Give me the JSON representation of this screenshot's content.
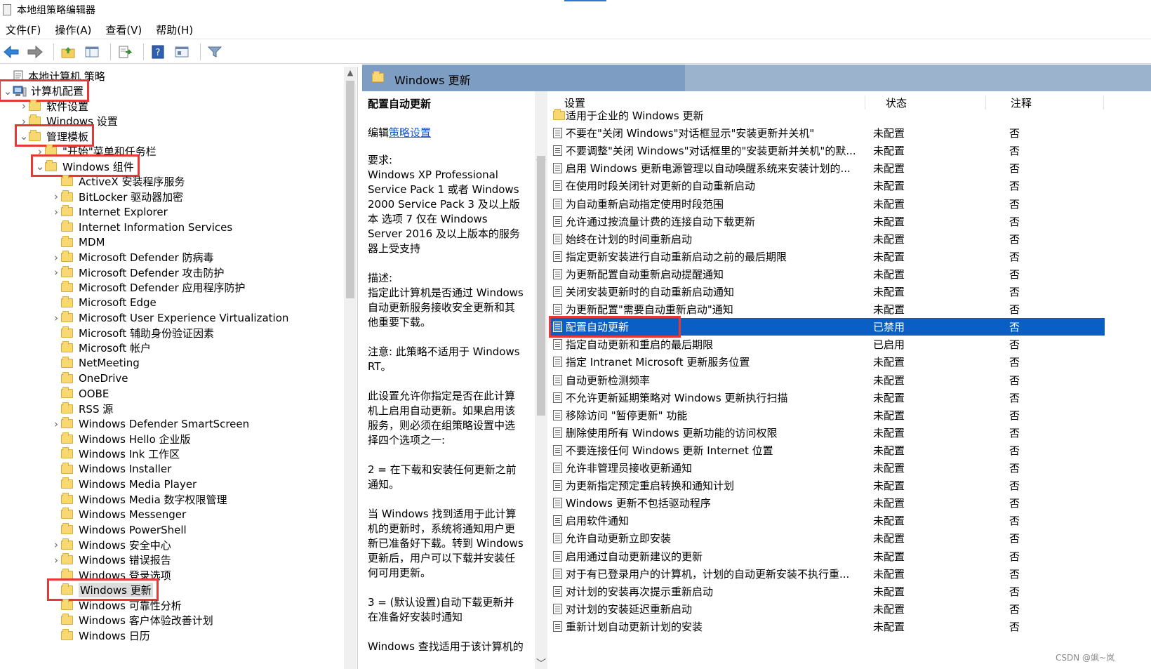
{
  "window": {
    "title": "本地组策略编辑器"
  },
  "menu": [
    "文件(F)",
    "操作(A)",
    "查看(V)",
    "帮助(H)"
  ],
  "toolbar": [
    "back-icon",
    "forward-icon",
    "up-folder-icon",
    "show-tree-icon",
    "export-icon",
    "help-icon",
    "properties-icon",
    "filter-icon"
  ],
  "tree": {
    "items": [
      {
        "label": "本地计算机 策略",
        "level": 0,
        "expander": "none",
        "icon": "policy-icon"
      },
      {
        "label": "计算机配置",
        "level": 0,
        "expander": "expanded",
        "icon": "computer-icon",
        "highlight": true
      },
      {
        "label": "软件设置",
        "level": 1,
        "expander": "collapsed"
      },
      {
        "label": "Windows 设置",
        "level": 1,
        "expander": "collapsed"
      },
      {
        "label": "管理模板",
        "level": 1,
        "expander": "expanded",
        "highlight": true
      },
      {
        "label": "\"开始\"菜单和任务栏",
        "level": 2,
        "expander": "collapsed"
      },
      {
        "label": "Windows 组件",
        "level": 2,
        "expander": "expanded",
        "highlight": true
      },
      {
        "label": "ActiveX 安装程序服务",
        "level": 3,
        "expander": "none"
      },
      {
        "label": "BitLocker 驱动器加密",
        "level": 3,
        "expander": "collapsed"
      },
      {
        "label": "Internet Explorer",
        "level": 3,
        "expander": "collapsed"
      },
      {
        "label": "Internet Information Services",
        "level": 3,
        "expander": "none"
      },
      {
        "label": "MDM",
        "level": 3,
        "expander": "none"
      },
      {
        "label": "Microsoft Defender 防病毒",
        "level": 3,
        "expander": "collapsed"
      },
      {
        "label": "Microsoft Defender 攻击防护",
        "level": 3,
        "expander": "collapsed"
      },
      {
        "label": "Microsoft Defender 应用程序防护",
        "level": 3,
        "expander": "none"
      },
      {
        "label": "Microsoft Edge",
        "level": 3,
        "expander": "none"
      },
      {
        "label": "Microsoft User Experience Virtualization",
        "level": 3,
        "expander": "collapsed"
      },
      {
        "label": "Microsoft 辅助身份验证因素",
        "level": 3,
        "expander": "none"
      },
      {
        "label": "Microsoft 帐户",
        "level": 3,
        "expander": "none"
      },
      {
        "label": "NetMeeting",
        "level": 3,
        "expander": "none"
      },
      {
        "label": "OneDrive",
        "level": 3,
        "expander": "none"
      },
      {
        "label": "OOBE",
        "level": 3,
        "expander": "none"
      },
      {
        "label": "RSS 源",
        "level": 3,
        "expander": "none"
      },
      {
        "label": "Windows Defender SmartScreen",
        "level": 3,
        "expander": "collapsed"
      },
      {
        "label": "Windows Hello 企业版",
        "level": 3,
        "expander": "none"
      },
      {
        "label": "Windows Ink 工作区",
        "level": 3,
        "expander": "none"
      },
      {
        "label": "Windows Installer",
        "level": 3,
        "expander": "none"
      },
      {
        "label": "Windows Media Player",
        "level": 3,
        "expander": "none"
      },
      {
        "label": "Windows Media 数字权限管理",
        "level": 3,
        "expander": "none"
      },
      {
        "label": "Windows Messenger",
        "level": 3,
        "expander": "none"
      },
      {
        "label": "Windows PowerShell",
        "level": 3,
        "expander": "none"
      },
      {
        "label": "Windows 安全中心",
        "level": 3,
        "expander": "collapsed"
      },
      {
        "label": "Windows 错误报告",
        "level": 3,
        "expander": "collapsed"
      },
      {
        "label": "Windows 登录选项",
        "level": 3,
        "expander": "none"
      },
      {
        "label": "Windows 更新",
        "level": 3,
        "expander": "none",
        "highlight": true,
        "selected": true
      },
      {
        "label": "Windows 可靠性分析",
        "level": 3,
        "expander": "none"
      },
      {
        "label": "Windows 客户体验改善计划",
        "level": 3,
        "expander": "none"
      },
      {
        "label": "Windows 日历",
        "level": 3,
        "expander": "none"
      }
    ]
  },
  "details": {
    "header_title": "Windows 更新",
    "extended": {
      "title": "配置自动更新",
      "edit_prefix": "编辑",
      "edit_link": "策略设置",
      "req_label": "要求:",
      "req_text": "Windows XP Professional Service Pack 1 或者 Windows 2000 Service Pack 3 及以上版本 选项 7 仅在 Windows Server 2016 及以上版本的服务器上受支持",
      "desc_label": "描述:",
      "desc_text": "指定此计算机是否通过 Windows 自动更新服务接收安全更新和其他重要下载。",
      "note_text": "注意: 此策略不适用于 Windows RT。",
      "para1": "此设置允许你指定是否在此计算机上启用自动更新。如果启用该服务，则必须在组策略设置中选择四个选项之一:",
      "para2": "2 = 在下载和安装任何更新之前通知。",
      "para3": "当 Windows 找到适用于此计算机的更新时，系统将通知用户更新已准备好下载。转到 Windows 更新后，用户可以下载并安装任何可用更新。",
      "para4": "3 = (默认设置)自动下载更新并在准备好安装时通知",
      "para5": "Windows 查找适用于该计算机的"
    },
    "columns": {
      "setting": "设置",
      "state": "状态",
      "note": "注释"
    },
    "rows": [
      {
        "name": "适用于企业的 Windows 更新",
        "state": "",
        "note": "",
        "type": "folder"
      },
      {
        "name": "不要在\"关闭 Windows\"对话框显示\"安装更新并关机\"",
        "state": "未配置",
        "note": "否"
      },
      {
        "name": "不要调整\"关闭 Windows\"对话框里的\"安装更新并关机\"的默...",
        "state": "未配置",
        "note": "否"
      },
      {
        "name": "启用 Windows 更新电源管理以自动唤醒系统来安装计划的...",
        "state": "未配置",
        "note": "否"
      },
      {
        "name": "在使用时段关闭针对更新的自动重新启动",
        "state": "未配置",
        "note": "否"
      },
      {
        "name": "为自动重新启动指定使用时段范围",
        "state": "未配置",
        "note": "否"
      },
      {
        "name": "允许通过按流量计费的连接自动下载更新",
        "state": "未配置",
        "note": "否"
      },
      {
        "name": "始终在计划的时间重新启动",
        "state": "未配置",
        "note": "否"
      },
      {
        "name": "指定更新安装进行自动重新启动之前的最后期限",
        "state": "未配置",
        "note": "否"
      },
      {
        "name": "为更新配置自动重新启动提醒通知",
        "state": "未配置",
        "note": "否"
      },
      {
        "name": "关闭安装更新时的自动重新启动通知",
        "state": "未配置",
        "note": "否"
      },
      {
        "name": "为更新配置\"需要自动重新启动\"通知",
        "state": "未配置",
        "note": "否"
      },
      {
        "name": "配置自动更新",
        "state": "已禁用",
        "note": "否",
        "selected": true
      },
      {
        "name": "指定自动更新和重启的最后期限",
        "state": "已启用",
        "note": "否"
      },
      {
        "name": "指定 Intranet Microsoft 更新服务位置",
        "state": "未配置",
        "note": "否"
      },
      {
        "name": "自动更新检测频率",
        "state": "未配置",
        "note": "否"
      },
      {
        "name": "不允许更新延期策略对 Windows 更新执行扫描",
        "state": "未配置",
        "note": "否"
      },
      {
        "name": "移除访问 \"暂停更新\" 功能",
        "state": "未配置",
        "note": "否"
      },
      {
        "name": "删除使用所有 Windows 更新功能的访问权限",
        "state": "未配置",
        "note": "否"
      },
      {
        "name": "不要连接任何 Windows 更新 Internet 位置",
        "state": "未配置",
        "note": "否"
      },
      {
        "name": "允许非管理员接收更新通知",
        "state": "未配置",
        "note": "否"
      },
      {
        "name": "为更新指定预定重启转换和通知计划",
        "state": "未配置",
        "note": "否"
      },
      {
        "name": "Windows 更新不包括驱动程序",
        "state": "未配置",
        "note": "否"
      },
      {
        "name": "启用软件通知",
        "state": "未配置",
        "note": "否"
      },
      {
        "name": "允许自动更新立即安装",
        "state": "未配置",
        "note": "否"
      },
      {
        "name": "启用通过自动更新建议的更新",
        "state": "未配置",
        "note": "否"
      },
      {
        "name": "对于有已登录用户的计算机，计划的自动更新安装不执行重...",
        "state": "未配置",
        "note": "否"
      },
      {
        "name": "对计划的安装再次提示重新启动",
        "state": "未配置",
        "note": "否"
      },
      {
        "name": "对计划的安装延迟重新启动",
        "state": "未配置",
        "note": "否"
      },
      {
        "name": "重新计划自动更新计划的安装",
        "state": "未配置",
        "note": "否"
      }
    ]
  },
  "watermark": "CSDN @飒~岚",
  "colors": {
    "selection": "#0a5fc4",
    "highlight_box": "#e53935",
    "header": "#9cb3ce",
    "link": "#1a56c8"
  }
}
